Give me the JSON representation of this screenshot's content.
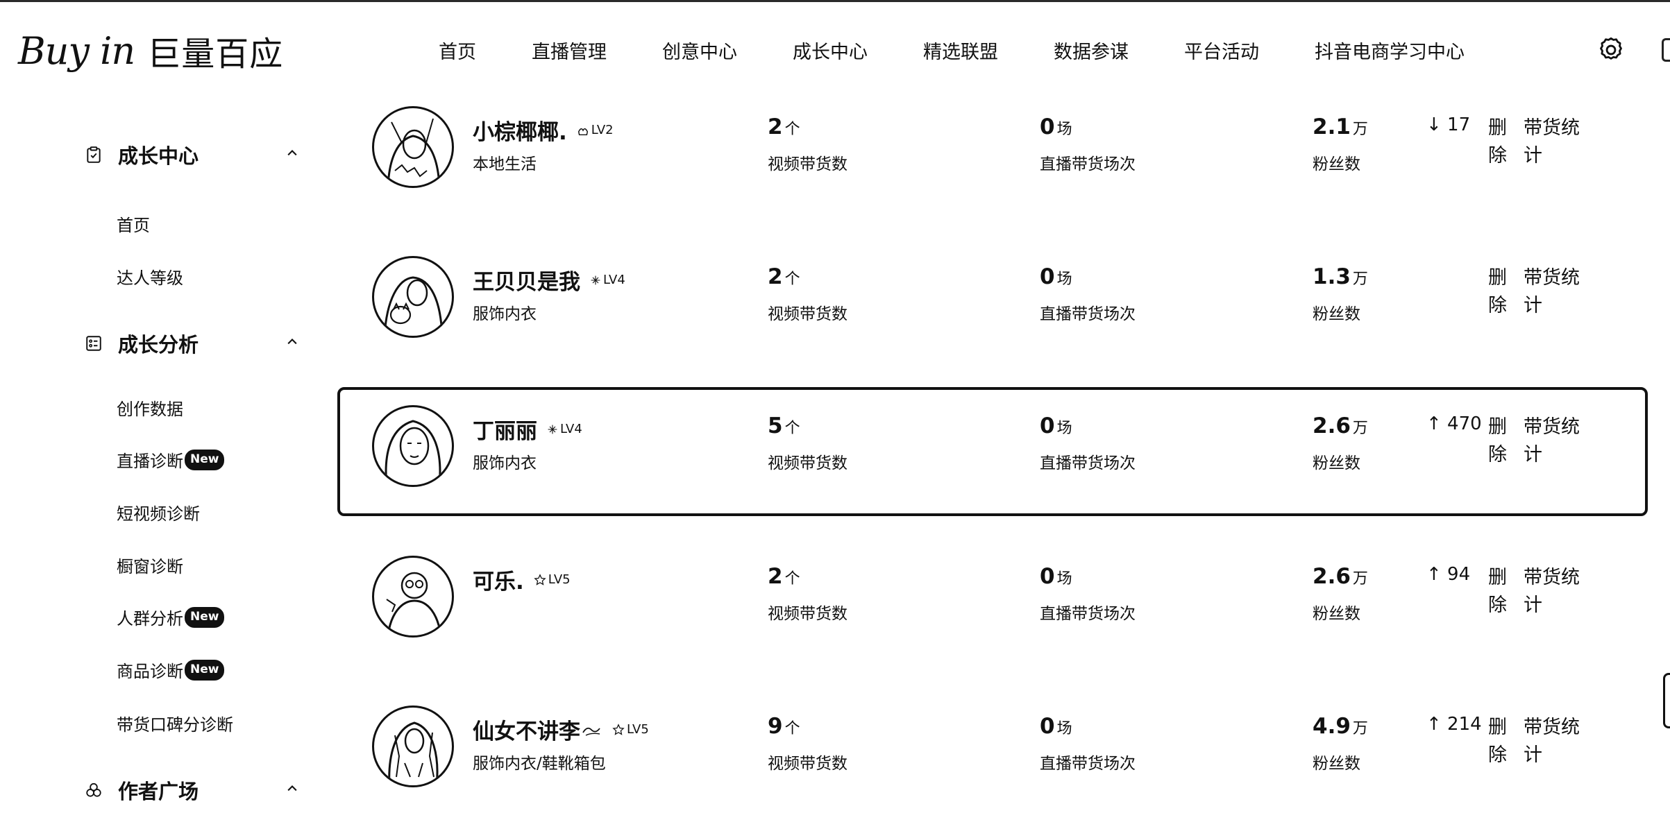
{
  "header": {
    "logo_text": "Buy in",
    "logo_cn": "巨量百应",
    "nav": [
      "首页",
      "直播管理",
      "创意中心",
      "成长中心",
      "精选联盟",
      "数据参谋",
      "平台活动",
      "抖音电商学习中心"
    ]
  },
  "sidebar": {
    "sections": [
      {
        "label": "成长中心",
        "icon": "clipboard-icon",
        "items": [
          "首页",
          "达人等级"
        ]
      },
      {
        "label": "成长分析",
        "icon": "list-card-icon",
        "items": [
          "创作数据",
          "直播诊断",
          "短视频诊断",
          "橱窗诊断",
          "人群分析",
          "商品诊断",
          "带货口碑分诊断"
        ]
      },
      {
        "label": "作者广场",
        "icon": "triple-circle-icon",
        "items": []
      }
    ],
    "new_badge": "New"
  },
  "rows": [
    {
      "name": "小棕椰椰.",
      "level": "LV2",
      "category": "本地生活",
      "video_count": "2",
      "video_unit": "个",
      "video_label": "视频带货数",
      "live_count": "0",
      "live_unit": "场",
      "live_label": "直播带货场次",
      "fans": "2.1",
      "fans_unit": "万",
      "fans_label": "粉丝数",
      "change": "↓ 17",
      "delete": "删除",
      "stats": "带货统计"
    },
    {
      "name": "王贝贝是我",
      "level": "LV4",
      "category": "服饰内衣",
      "video_count": "2",
      "video_unit": "个",
      "video_label": "视频带货数",
      "live_count": "0",
      "live_unit": "场",
      "live_label": "直播带货场次",
      "fans": "1.3",
      "fans_unit": "万",
      "fans_label": "粉丝数",
      "change": "",
      "delete": "删除",
      "stats": "带货统计"
    },
    {
      "name": "丁丽丽",
      "level": "LV4",
      "category": "服饰内衣",
      "video_count": "5",
      "video_unit": "个",
      "video_label": "视频带货数",
      "live_count": "0",
      "live_unit": "场",
      "live_label": "直播带货场次",
      "fans": "2.6",
      "fans_unit": "万",
      "fans_label": "粉丝数",
      "change": "↑ 470",
      "delete": "删除",
      "stats": "带货统计"
    },
    {
      "name": "可乐.",
      "level": "LV5",
      "category": "",
      "video_count": "2",
      "video_unit": "个",
      "video_label": "视频带货数",
      "live_count": "0",
      "live_unit": "场",
      "live_label": "直播带货场次",
      "fans": "2.6",
      "fans_unit": "万",
      "fans_label": "粉丝数",
      "change": "↑ 94",
      "delete": "删除",
      "stats": "带货统计"
    },
    {
      "name": "仙女不讲李",
      "level": "LV5",
      "category": "服饰内衣/鞋靴箱包",
      "video_count": "9",
      "video_unit": "个",
      "video_label": "视频带货数",
      "live_count": "0",
      "live_unit": "场",
      "live_label": "直播带货场次",
      "fans": "4.9",
      "fans_unit": "万",
      "fans_label": "粉丝数",
      "change": "↑ 214",
      "delete": "删除",
      "stats": "带货统计"
    }
  ],
  "selected_row": 2
}
